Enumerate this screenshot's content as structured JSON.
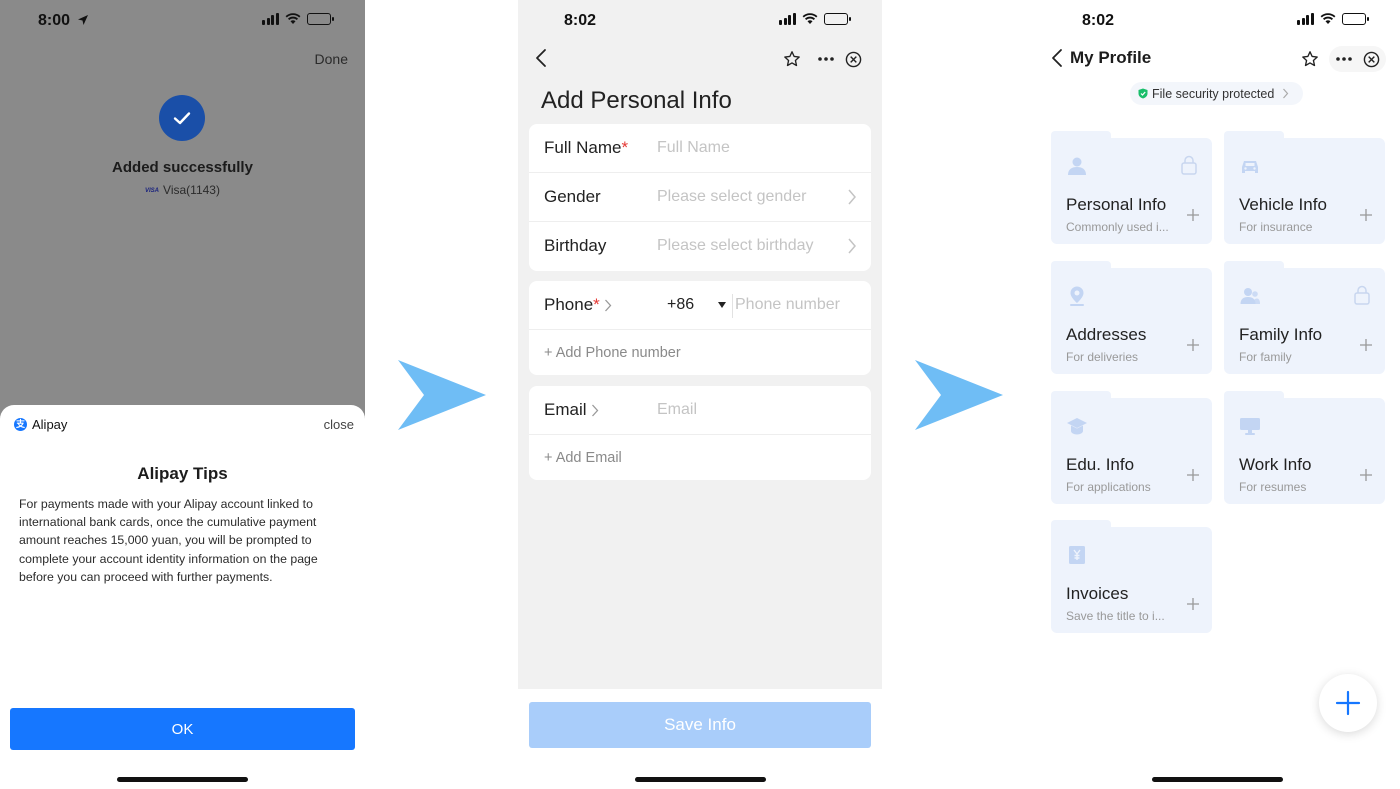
{
  "status": {
    "screen1_time": "8:00",
    "screen2_time": "8:02",
    "screen3_time": "8:02"
  },
  "screen1": {
    "done_label": "Done",
    "success_title": "Added successfully",
    "card_brand": "VISA",
    "card_label": "Visa(1143)",
    "sheet": {
      "brand": "Alipay",
      "close_label": "close",
      "title": "Alipay Tips",
      "body": "For payments made with your Alipay account linked to international bank cards, once the cumulative payment amount reaches 15,000 yuan, you will be prompted to complete your account identity information on the page before you can proceed with further payments.",
      "ok_label": "OK"
    }
  },
  "screen2": {
    "title": "Add Personal Info",
    "fields": {
      "full_name_label": "Full Name",
      "full_name_placeholder": "Full Name",
      "gender_label": "Gender",
      "gender_placeholder": "Please select gender",
      "birthday_label": "Birthday",
      "birthday_placeholder": "Please select birthday",
      "phone_label": "Phone",
      "phone_code": "+86",
      "phone_placeholder": "Phone number",
      "add_phone": "+ Add Phone number",
      "email_label": "Email",
      "email_placeholder": "Email",
      "add_email": "+ Add Email"
    },
    "required_mark": "*",
    "save_label": "Save Info"
  },
  "screen3": {
    "title": "My Profile",
    "security_label": "File security protected",
    "tiles": [
      {
        "title": "Personal Info",
        "subtitle": "Commonly used i...",
        "icon": "person-icon",
        "locked": true
      },
      {
        "title": "Vehicle Info",
        "subtitle": "For insurance",
        "icon": "car-icon",
        "locked": false
      },
      {
        "title": "Addresses",
        "subtitle": "For deliveries",
        "icon": "location-pin-icon",
        "locked": false
      },
      {
        "title": "Family Info",
        "subtitle": "For family",
        "icon": "family-icon",
        "locked": true
      },
      {
        "title": "Edu. Info",
        "subtitle": "For applications",
        "icon": "graduation-cap-icon",
        "locked": false
      },
      {
        "title": "Work Info",
        "subtitle": "For resumes",
        "icon": "monitor-icon",
        "locked": false
      },
      {
        "title": "Invoices",
        "subtitle": "Save the title to i...",
        "icon": "invoice-icon",
        "locked": false
      }
    ]
  },
  "colors": {
    "alipay_blue": "#1677ff",
    "disabled_blue": "#a9cdfa",
    "tile_bg": "#eef3fc",
    "arrow": "#6fbdf5",
    "required_red": "#e53935",
    "secure_green": "#19be6b"
  }
}
